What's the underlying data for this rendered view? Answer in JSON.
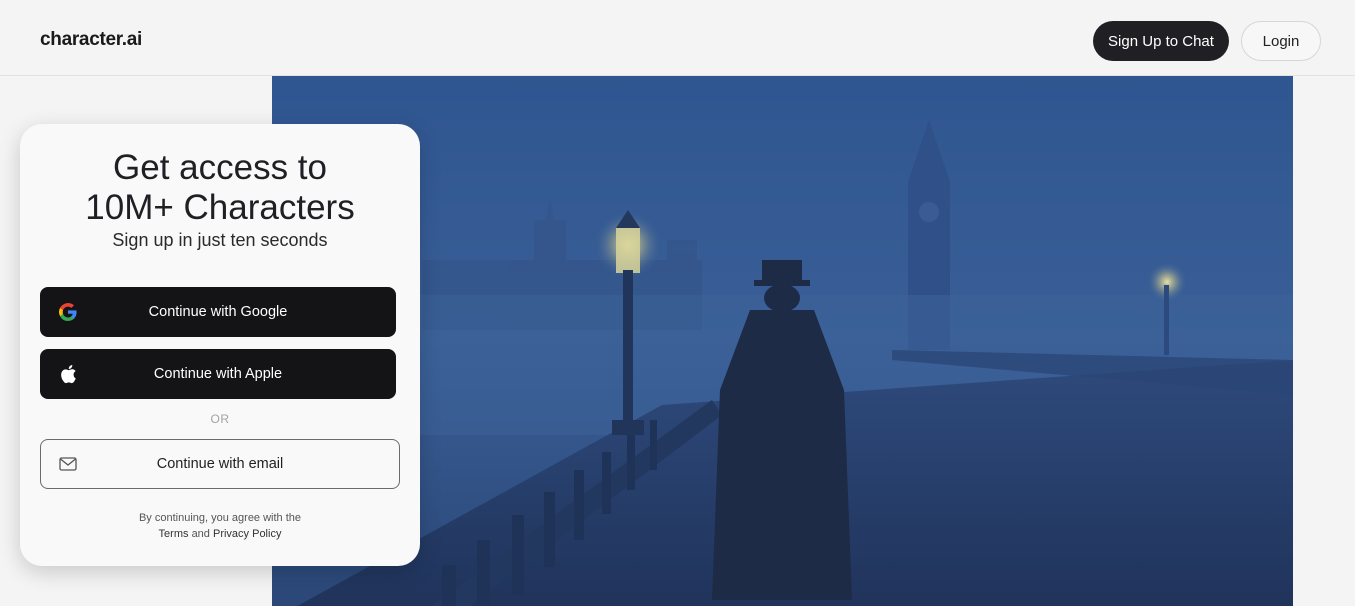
{
  "header": {
    "logo": "character.ai",
    "signup_label": "Sign Up to Chat",
    "login_label": "Login"
  },
  "hero": {
    "icon": "foggy-london-bridge-illustration",
    "colors": {
      "sky": "#32578f",
      "fog": "#3b5f96",
      "figure": "#1f2d48",
      "lamp_glow": "#f2e59a"
    }
  },
  "card": {
    "title": "Get access to\n10M+ Characters",
    "subtitle": "Sign up in just ten seconds",
    "google_label": "Continue with Google",
    "apple_label": "Continue with Apple",
    "or_label": "OR",
    "email_label": "Continue with email",
    "legal_prefix": "By continuing, you agree with the",
    "terms_label": "Terms",
    "and_label": "and",
    "privacy_label": "Privacy Policy"
  }
}
